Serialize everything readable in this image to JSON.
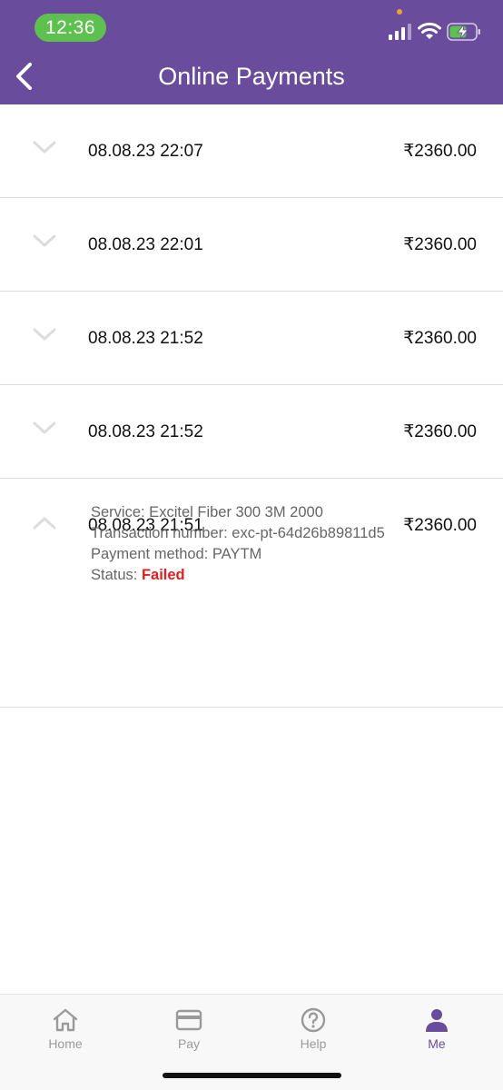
{
  "status_bar": {
    "time": "12:36"
  },
  "header": {
    "title": "Online Payments"
  },
  "payments": [
    {
      "date": "08.08.23 22:07",
      "amount": "₹2360.00"
    },
    {
      "date": "08.08.23 22:01",
      "amount": "₹2360.00"
    },
    {
      "date": "08.08.23 21:52",
      "amount": "₹2360.00"
    },
    {
      "date": "08.08.23 21:52",
      "amount": "₹2360.00"
    },
    {
      "date": "08.08.23 21:51",
      "amount": "₹2360.00"
    }
  ],
  "expanded_details": {
    "service": "Service: Excitel Fiber 300 3M 2000",
    "transaction": "Transaction number: exc-pt-64d26b89811d5",
    "payment_method": "Payment method: PAYTM",
    "status_label": "Status: ",
    "status_value": "Failed"
  },
  "tabs": [
    {
      "label": "Home",
      "icon": "home-icon"
    },
    {
      "label": "Pay",
      "icon": "card-icon"
    },
    {
      "label": "Help",
      "icon": "help-icon"
    },
    {
      "label": "Me",
      "icon": "person-icon"
    }
  ],
  "colors": {
    "brand": "#6a4c9c",
    "time_pill": "#5ec04f",
    "failed": "#e02020",
    "tab_inactive": "#9a9a9a"
  }
}
